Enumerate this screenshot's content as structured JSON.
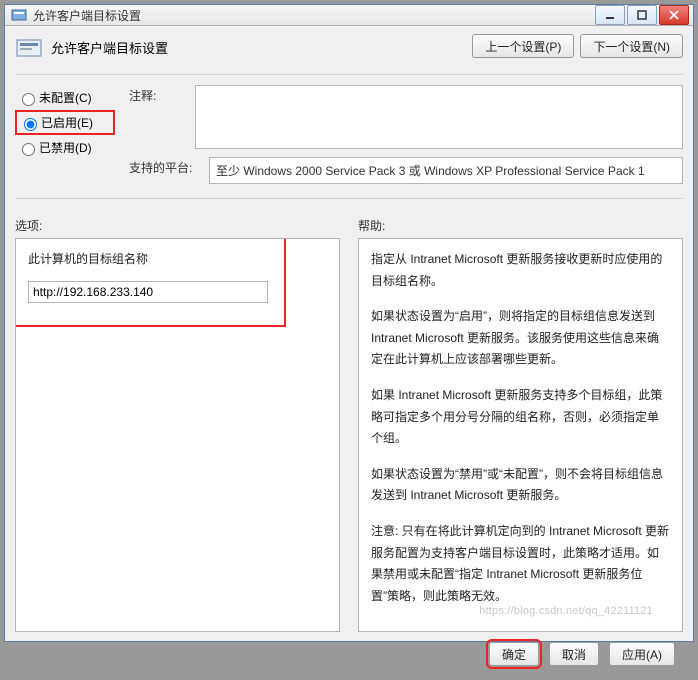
{
  "window": {
    "title": "允许客户端目标设置"
  },
  "header": {
    "title": "允许客户端目标设置",
    "prev_btn": "上一个设置(P)",
    "next_btn": "下一个设置(N)"
  },
  "radios": {
    "not_configured": "未配置(C)",
    "enabled": "已启用(E)",
    "disabled": "已禁用(D)",
    "selected": "enabled"
  },
  "comment": {
    "label": "注释:",
    "value": ""
  },
  "platform": {
    "label": "支持的平台:",
    "value": "至少 Windows 2000 Service Pack 3 或 Windows XP Professional Service Pack 1"
  },
  "options": {
    "label": "选项:",
    "target_group_label": "此计算机的目标组名称",
    "target_group_value": "http://192.168.233.140"
  },
  "help": {
    "label": "帮助:",
    "p1": "指定从 Intranet Microsoft 更新服务接收更新时应使用的目标组名称。",
    "p2": "如果状态设置为“启用”，则将指定的目标组信息发送到 Intranet Microsoft 更新服务。该服务使用这些信息来确定在此计算机上应该部署哪些更新。",
    "p3": "如果 Intranet Microsoft 更新服务支持多个目标组，此策略可指定多个用分号分隔的组名称，否则，必须指定单个组。",
    "p4": "如果状态设置为“禁用”或“未配置”，则不会将目标组信息发送到 Intranet Microsoft 更新服务。",
    "p5": "注意: 只有在将此计算机定向到的 Intranet Microsoft 更新服务配置为支持客户端目标设置时，此策略才适用。如果禁用或未配置“指定 Intranet Microsoft 更新服务位置”策略，则此策略无效。"
  },
  "footer": {
    "ok": "确定",
    "cancel": "取消",
    "apply": "应用(A)"
  },
  "watermark": "https://blog.csdn.net/qq_42211121"
}
